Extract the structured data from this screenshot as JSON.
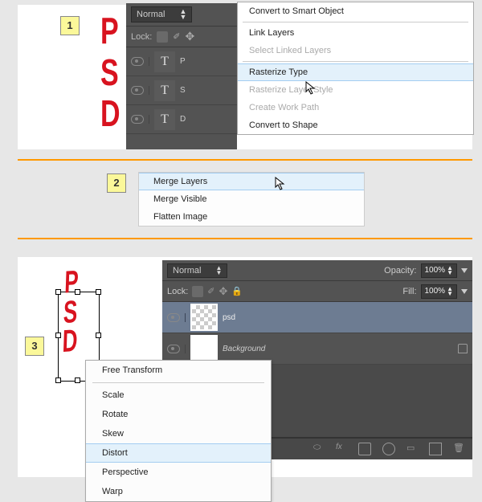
{
  "steps": {
    "s1": "1",
    "s2": "2",
    "s3": "3"
  },
  "panel1": {
    "blendMode": "Normal",
    "lockLabel": "Lock:",
    "layers": [
      {
        "thumb": "T",
        "name": "P"
      },
      {
        "thumb": "T",
        "name": "S"
      },
      {
        "thumb": "T",
        "name": "D"
      }
    ]
  },
  "psd": {
    "p": "P",
    "s": "S",
    "d": "D"
  },
  "menu1": {
    "convertSmart": "Convert to Smart Object",
    "linkLayers": "Link Layers",
    "selectLinked": "Select Linked Layers",
    "rasterizeType": "Rasterize Type",
    "rasterizeStyle": "Rasterize Layer Style",
    "createWorkPath": "Create Work Path",
    "convertShape": "Convert to Shape"
  },
  "menu2": {
    "merge": "Merge Layers",
    "mergeVisible": "Merge Visible",
    "flatten": "Flatten Image"
  },
  "panel3": {
    "blendMode": "Normal",
    "opacityLabel": "Opacity:",
    "opacityVal": "100%",
    "lockLabel": "Lock:",
    "fillLabel": "Fill:",
    "fillVal": "100%",
    "layers": [
      {
        "name": "psd"
      },
      {
        "name": "Background"
      }
    ]
  },
  "menu3": {
    "free": "Free Transform",
    "scale": "Scale",
    "rotate": "Rotate",
    "skew": "Skew",
    "distort": "Distort",
    "perspective": "Perspective",
    "warp": "Warp"
  }
}
